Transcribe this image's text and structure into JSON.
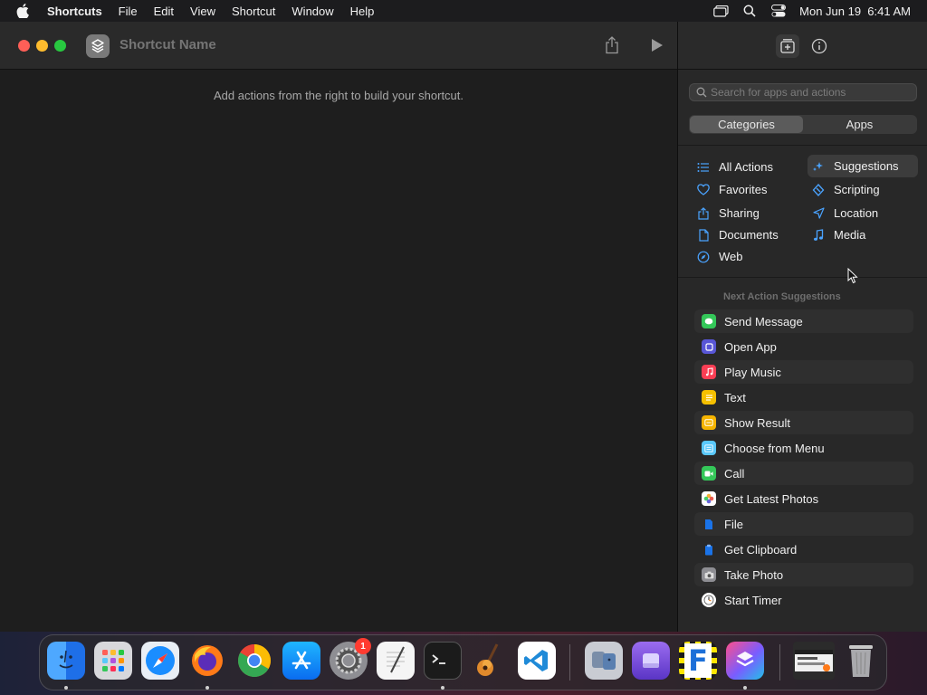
{
  "menubar": {
    "app_name": "Shortcuts",
    "items": [
      "File",
      "Edit",
      "View",
      "Shortcut",
      "Window",
      "Help"
    ],
    "clock": "Mon Jun 19  6:41 AM",
    "icons": [
      "display-icon",
      "spotlight-icon",
      "control-center-icon"
    ]
  },
  "window": {
    "shortcut_name_placeholder": "Shortcut Name",
    "hint": "Add actions from the right to build your shortcut.",
    "toolbar_icons": [
      "share-icon",
      "play-icon"
    ]
  },
  "sidebar": {
    "top_icons": [
      "action-library-icon",
      "info-icon"
    ],
    "search_placeholder": "Search for apps and actions",
    "segments": [
      "Categories",
      "Apps"
    ],
    "active_segment": "Categories",
    "categories": [
      {
        "label": "All Actions",
        "icon": "list-icon",
        "color": "#4aa3ff"
      },
      {
        "label": "Suggestions",
        "icon": "sparkle-icon",
        "color": "#4aa3ff"
      },
      {
        "label": "Favorites",
        "icon": "heart-icon",
        "color": "#4aa3ff"
      },
      {
        "label": "Scripting",
        "icon": "scripting-icon",
        "color": "#4aa3ff"
      },
      {
        "label": "Sharing",
        "icon": "share-icon",
        "color": "#4aa3ff"
      },
      {
        "label": "Location",
        "icon": "location-arrow-icon",
        "color": "#4aa3ff"
      },
      {
        "label": "Documents",
        "icon": "document-icon",
        "color": "#4aa3ff"
      },
      {
        "label": "Media",
        "icon": "music-note-icon",
        "color": "#4aa3ff"
      },
      {
        "label": "Web",
        "icon": "compass-icon",
        "color": "#4aa3ff"
      }
    ],
    "active_category": "Suggestions",
    "next_action_title": "Next Action Suggestions",
    "suggestions": [
      {
        "label": "Send Message",
        "icon": "messages-icon",
        "color": "#34c759"
      },
      {
        "label": "Open App",
        "icon": "open-app-icon",
        "color": "#5856d6"
      },
      {
        "label": "Play Music",
        "icon": "music-icon",
        "color": "#fa3e54"
      },
      {
        "label": "Text",
        "icon": "text-icon",
        "color": "#f5c000"
      },
      {
        "label": "Show Result",
        "icon": "show-result-icon",
        "color": "#f5b400"
      },
      {
        "label": "Choose from Menu",
        "icon": "menu-icon",
        "color": "#5ac8fa"
      },
      {
        "label": "Call",
        "icon": "facetime-icon",
        "color": "#34c759"
      },
      {
        "label": "Get Latest Photos",
        "icon": "photos-icon",
        "color": "#ffffff"
      },
      {
        "label": "File",
        "icon": "file-icon",
        "color": "#1a73e8"
      },
      {
        "label": "Get Clipboard",
        "icon": "clipboard-icon",
        "color": "#1a73e8"
      },
      {
        "label": "Take Photo",
        "icon": "camera-icon",
        "color": "#8e8e93"
      },
      {
        "label": "Start Timer",
        "icon": "clock-icon",
        "color": "#ffffff"
      }
    ]
  },
  "dock": {
    "apps": [
      {
        "name": "finder-icon"
      },
      {
        "name": "launchpad-icon"
      },
      {
        "name": "safari-icon"
      },
      {
        "name": "firefox-icon"
      },
      {
        "name": "chrome-icon"
      },
      {
        "name": "app-store-icon"
      },
      {
        "name": "system-settings-icon",
        "badge": "1"
      },
      {
        "name": "textedit-icon"
      },
      {
        "name": "terminal-icon"
      },
      {
        "name": "garageband-icon"
      },
      {
        "name": "vscode-icon"
      },
      {
        "name": "migration-assistant-icon"
      },
      {
        "name": "disk-utility-icon"
      },
      {
        "name": "fontforge-icon"
      },
      {
        "name": "shortcuts-icon"
      },
      {
        "name": "screenshot-thumbnail-icon"
      },
      {
        "name": "trash-icon"
      }
    ]
  }
}
